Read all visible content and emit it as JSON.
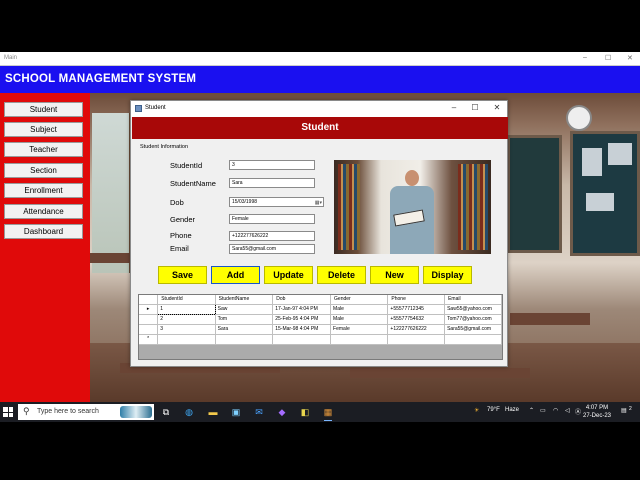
{
  "os_window": {
    "title": "Main",
    "min": "–",
    "max": "☐",
    "close": "✕"
  },
  "app": {
    "title": "SCHOOL MANAGEMENT SYSTEM"
  },
  "sidebar": {
    "items": [
      {
        "label": "Student"
      },
      {
        "label": "Subject"
      },
      {
        "label": "Teacher"
      },
      {
        "label": "Section"
      },
      {
        "label": "Enrollment"
      },
      {
        "label": "Attendance"
      },
      {
        "label": "Dashboard"
      }
    ]
  },
  "dialog": {
    "title": "Student",
    "banner": "Student",
    "group_label": "Student Information",
    "controls": {
      "min": "–",
      "max": "☐",
      "close": "✕"
    },
    "fields": {
      "student_id": {
        "label": "StudentId",
        "value": "3"
      },
      "student_name": {
        "label": "StudentName",
        "value": "Sara"
      },
      "dob": {
        "label": "Dob",
        "value": "15/03/1998"
      },
      "gender": {
        "label": "Gender",
        "value": "Female"
      },
      "phone": {
        "label": "Phone",
        "value": "+122277626222"
      },
      "email": {
        "label": "Email",
        "value": "Sara55@gmail.com"
      }
    },
    "buttons": {
      "save": "Save",
      "add": "Add",
      "update": "Update",
      "delete": "Delete",
      "new": "New",
      "display": "Display"
    },
    "grid": {
      "columns": [
        "StudentId",
        "StudentName",
        "Dob",
        "Gender",
        "Phone",
        "Email"
      ],
      "rows": [
        [
          "1",
          "Saw",
          "17-Jan-97 4:04 PM",
          "Male",
          "+55577712345",
          "Saw55@yahoo.com"
        ],
        [
          "2",
          "Tom",
          "25-Feb-95 4:04 PM",
          "Male",
          "+55577754632",
          "Tom77@yahoo.com"
        ],
        [
          "3",
          "Sara",
          "15-Mar-98 4:04 PM",
          "Female",
          "+122277626222",
          "Sara55@gmail.com"
        ]
      ],
      "current_row_marker": "▸",
      "new_row_marker": "*"
    }
  },
  "taskbar": {
    "search_placeholder": "Type here to search",
    "weather_temp": "79°F",
    "weather_desc": "Haze",
    "time": "4:07 PM",
    "date": "27-Dec-23",
    "notification_count": "2"
  },
  "colors": {
    "header_blue": "#1a10f0",
    "sidebar_red": "#e00a0a",
    "banner_red": "#a80808",
    "button_yellow": "#ffff00"
  }
}
